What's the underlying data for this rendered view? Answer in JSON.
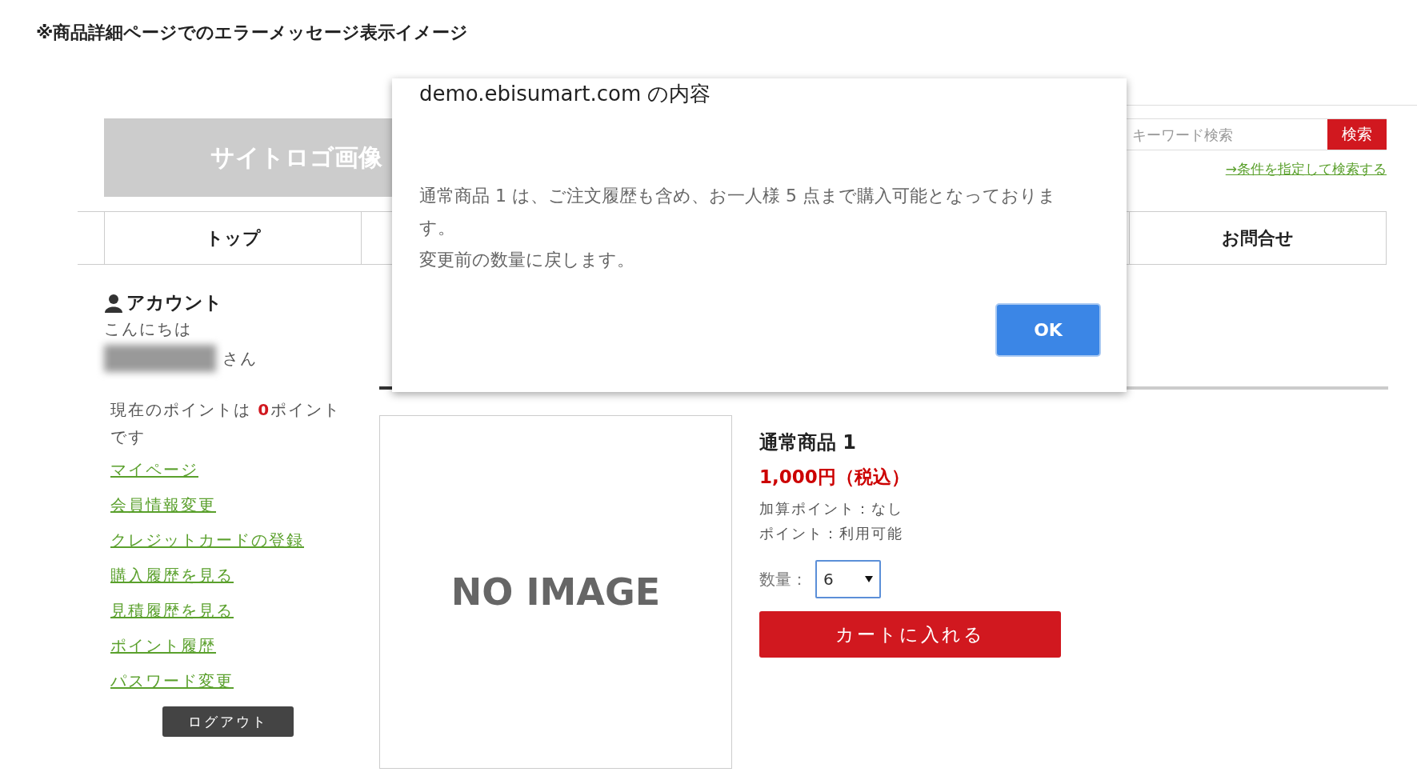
{
  "page_title": "※商品詳細ページでのエラーメッセージ表示イメージ",
  "header": {
    "logo": "サイトロゴ画像",
    "search": {
      "placeholder": "キーワード検索",
      "button": "検索"
    },
    "advanced_search_link": "→条件を指定して検索する"
  },
  "nav": [
    {
      "label": "トップ"
    },
    {
      "label": "お問合せ"
    }
  ],
  "sidebar": {
    "heading": "アカウント",
    "greeting": "こんにちは",
    "name_suffix": "さん",
    "points": "現在のポイントは **0**ポイントです",
    "links": [
      "マイページ",
      "会員情報変更",
      "クレジットカードの登録",
      "購入履歴を見る",
      "見積履歴を見る",
      "ポイント履歴",
      "パスワード変更"
    ],
    "logout": "ログアウト"
  },
  "product": {
    "image_text": "NO IMAGE",
    "name": "通常商品 1",
    "price": "1,000円（税込）",
    "point_info": [
      "加算ポイント：なし",
      "ポイント：利用可能"
    ],
    "quantity_label": "数量：",
    "quantity": "6",
    "add_to_cart": "カートに入れる"
  },
  "dialog": {
    "title": "demo.ebisumart.com の内容",
    "message": [
      "通常商品 1 は、ご注文履歴も含め、お一人様 5 点まで購入可能となっております。",
      "変更前の数量に戻します。"
    ],
    "button": "OK"
  }
}
